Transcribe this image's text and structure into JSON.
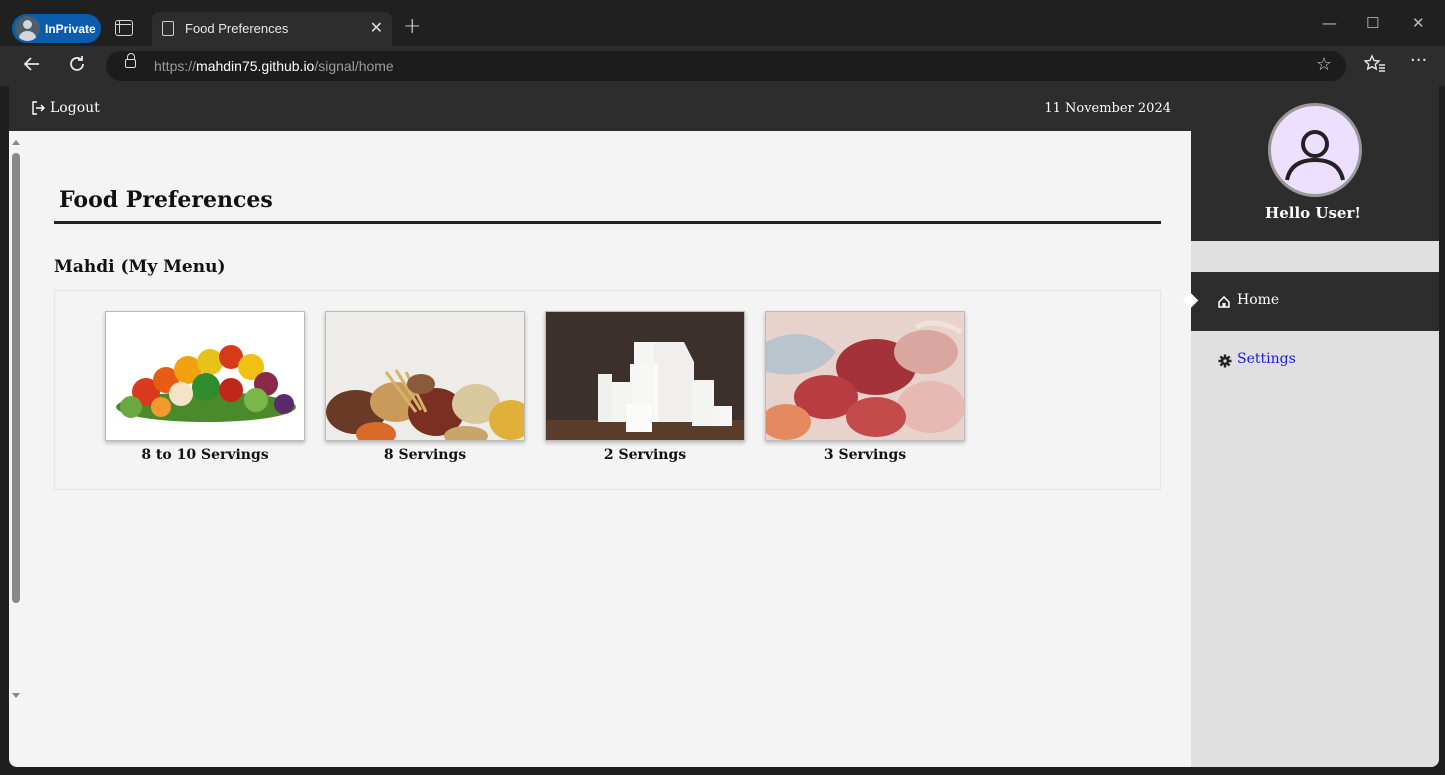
{
  "browser": {
    "profile_label": "InPrivate",
    "tab_title": "Food Preferences",
    "tab_close": "✕",
    "new_tab": "+",
    "url_scheme": "https://",
    "url_host": "mahdin75.github.io",
    "url_path": "/signal/home",
    "window_controls": {
      "minimize": "—",
      "maximize": "☐",
      "close": "✕"
    }
  },
  "topbar": {
    "logout_label": "Logout",
    "date": "11 November 2024"
  },
  "main": {
    "page_title": "Food Preferences",
    "menu_title": "Mahdi (My Menu)",
    "foods": [
      {
        "icon": "vegetables-image",
        "servings": "8 to 10 Servings"
      },
      {
        "icon": "grains-image",
        "servings": "8 Servings"
      },
      {
        "icon": "milk-image",
        "servings": "2 Servings"
      },
      {
        "icon": "meat-image",
        "servings": "3 Servings"
      }
    ]
  },
  "sidebar": {
    "greeting": "Hello User!",
    "nav": [
      {
        "label": "Home",
        "icon": "home-icon",
        "active": true
      },
      {
        "label": "Settings",
        "icon": "gear-icon",
        "active": false
      }
    ]
  },
  "colors": {
    "topbar_bg": "#2d2d2d",
    "page_bg": "#f4f4f4",
    "sidebar_bg": "#e0e0e0",
    "avatar_bg": "#ecdfff",
    "link": "#1a1adb",
    "inprivate_badge": "#0b5cad"
  }
}
